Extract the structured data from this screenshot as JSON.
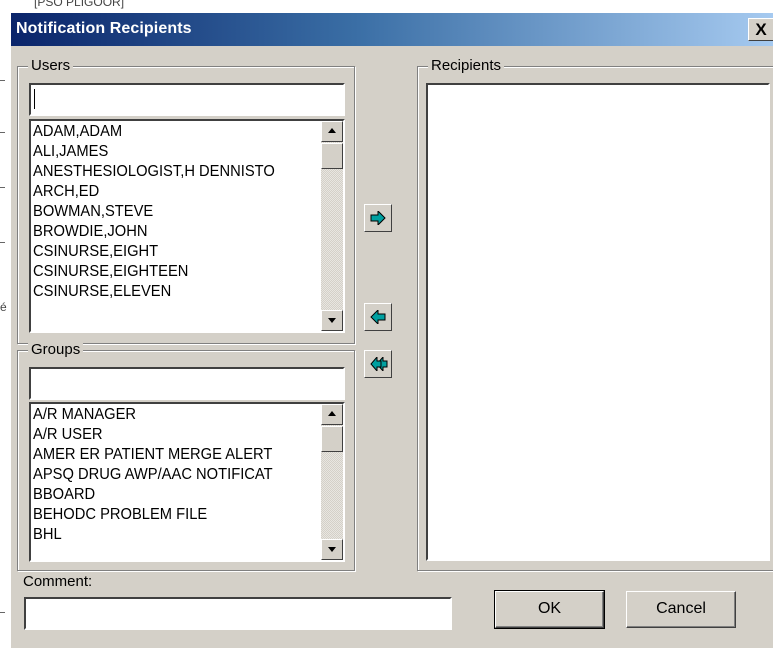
{
  "background": {
    "fragment": "[PSO PLIGOOR]",
    "edge_char": "é"
  },
  "window": {
    "title": "Notification Recipients",
    "close_glyph": "X"
  },
  "users": {
    "label": "Users",
    "search_value": "",
    "items": [
      "ADAM,ADAM",
      "ALI,JAMES",
      "ANESTHESIOLOGIST,H DENNISTO",
      "ARCH,ED",
      "BOWMAN,STEVE",
      "BROWDIE,JOHN",
      "CSINURSE,EIGHT",
      "CSINURSE,EIGHTEEN",
      "CSINURSE,ELEVEN"
    ]
  },
  "groups": {
    "label": "Groups",
    "search_value": "",
    "items": [
      "A/R MANAGER",
      "A/R USER",
      "AMER ER PATIENT MERGE ALERT",
      "APSQ DRUG AWP/AAC NOTIFICAT",
      "BBOARD",
      "BEHODC PROBLEM FILE",
      "BHL"
    ]
  },
  "recipients": {
    "label": "Recipients",
    "items": []
  },
  "transfer_buttons": {
    "add_icon": "arrow-right-icon",
    "remove_icon": "arrow-left-icon",
    "remove_all_icon": "double-arrow-left-icon",
    "arrow_color": "#00a0a0"
  },
  "comment": {
    "label": "Comment:",
    "value": ""
  },
  "actions": {
    "ok": "OK",
    "cancel": "Cancel"
  }
}
